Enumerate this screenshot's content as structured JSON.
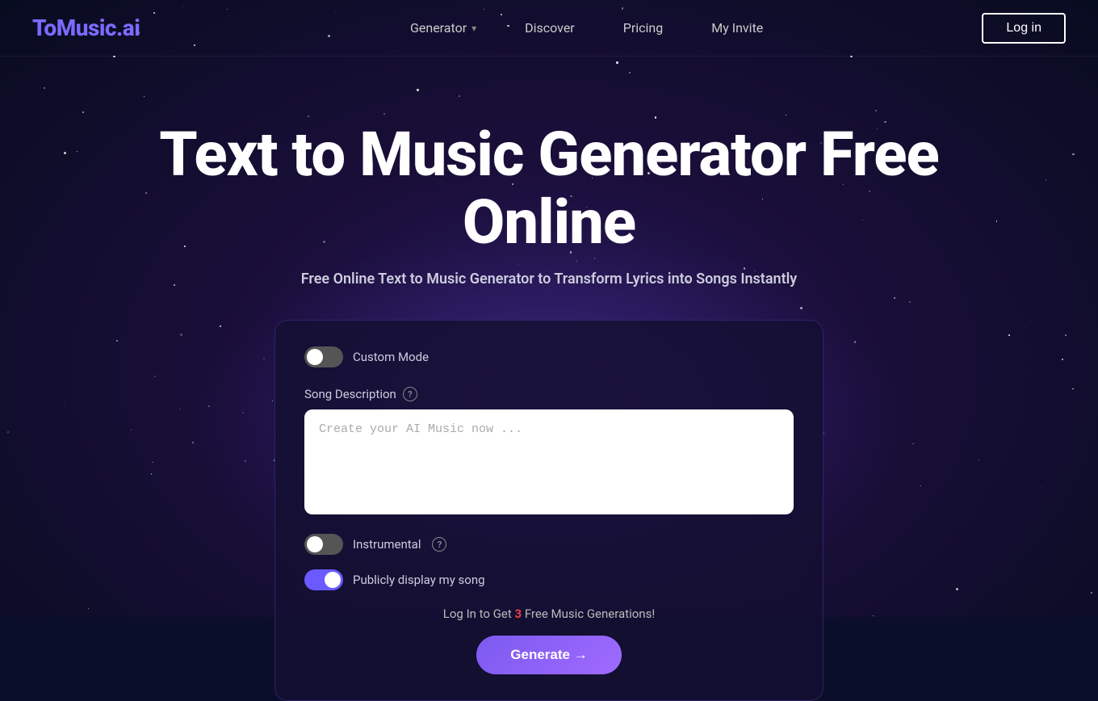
{
  "brand": {
    "name_part1": "ToMusic",
    "name_part2": ".ai"
  },
  "nav": {
    "links": [
      {
        "label": "Generator",
        "has_chevron": true
      },
      {
        "label": "Discover",
        "has_chevron": false
      },
      {
        "label": "Pricing",
        "has_chevron": false
      },
      {
        "label": "My Invite",
        "has_chevron": false
      }
    ],
    "login_label": "Log in"
  },
  "hero": {
    "title": "Text to Music Generator Free Online",
    "subtitle": "Free Online Text to Music Generator to Transform Lyrics into Songs Instantly"
  },
  "card": {
    "custom_mode_label": "Custom Mode",
    "custom_mode_active": false,
    "song_description_label": "Song Description",
    "song_description_placeholder": "Create your AI Music now ...",
    "instrumental_label": "Instrumental",
    "instrumental_active": false,
    "public_label": "Publicly display my song",
    "public_active": true,
    "login_prompt_prefix": "Log In to Get ",
    "login_prompt_count": "3",
    "login_prompt_suffix": " Free Music Generations!",
    "generate_label": "Generate →"
  },
  "colors": {
    "accent": "#7c5af0",
    "toggle_active": "#6a5aff",
    "toggle_inactive": "#555555",
    "danger": "#e84040"
  }
}
